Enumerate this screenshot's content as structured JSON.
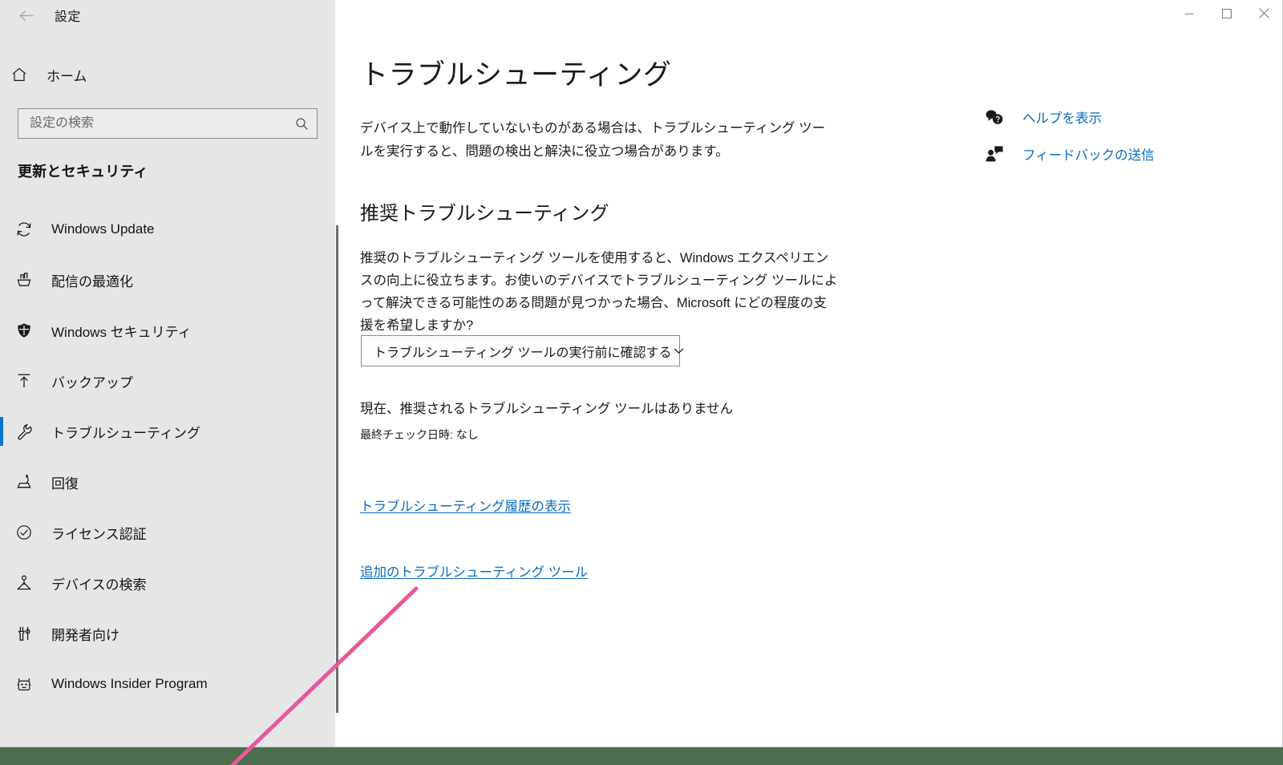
{
  "window": {
    "title": "設定",
    "back_icon": "back-arrow-icon",
    "controls": {
      "minimize": "minimize-icon",
      "maximize": "maximize-icon",
      "close": "close-icon"
    }
  },
  "sidebar": {
    "home": {
      "label": "ホーム",
      "icon": "home-icon"
    },
    "search": {
      "placeholder": "設定の検索",
      "value": "",
      "icon": "search-icon"
    },
    "group_title": "更新とセキュリティ",
    "items": [
      {
        "label": "Windows Update",
        "icon": "sync-refresh-icon",
        "selected": false
      },
      {
        "label": "配信の最適化",
        "icon": "delivery-optimization-icon",
        "selected": false
      },
      {
        "label": "Windows セキュリティ",
        "icon": "shield-icon",
        "selected": false
      },
      {
        "label": "バックアップ",
        "icon": "backup-upload-icon",
        "selected": false
      },
      {
        "label": "トラブルシューティング",
        "icon": "wrench-icon",
        "selected": true
      },
      {
        "label": "回復",
        "icon": "recovery-icon",
        "selected": false
      },
      {
        "label": "ライセンス認証",
        "icon": "check-circle-icon",
        "selected": false
      },
      {
        "label": "デバイスの検索",
        "icon": "find-device-icon",
        "selected": false
      },
      {
        "label": "開発者向け",
        "icon": "developer-tools-icon",
        "selected": false
      },
      {
        "label": "Windows Insider Program",
        "icon": "insider-cat-icon",
        "selected": false
      }
    ],
    "accent_color": "#0078d4"
  },
  "main": {
    "page_title": "トラブルシューティング",
    "intro_text": "デバイス上で動作していないものがある場合は、トラブルシューティング ツールを実行すると、問題の検出と解決に役立つ場合があります。",
    "section_title": "推奨トラブルシューティング",
    "section_text": "推奨のトラブルシューティング ツールを使用すると、Windows エクスペリエンスの向上に役立ちます。お使いのデバイスでトラブルシューティング ツールによって解決できる可能性のある問題が見つかった場合、Microsoft にどの程度の支援を希望しますか?",
    "dropdown": {
      "value": "トラブルシューティング ツールの実行前に確認する",
      "chevron_icon": "chevron-down-icon"
    },
    "status_primary": "現在、推奨されるトラブルシューティング ツールはありません",
    "status_secondary": "最終チェック日時: なし",
    "links": [
      {
        "label": "トラブルシューティング履歴の表示"
      },
      {
        "label": "追加のトラブルシューティング ツール"
      }
    ],
    "link_color": "#0a6cbd"
  },
  "help": {
    "items": [
      {
        "label": "ヘルプを表示",
        "icon": "help-question-bubble-icon"
      },
      {
        "label": "フィードバックの送信",
        "icon": "feedback-person-icon"
      }
    ]
  },
  "annotation": {
    "color": "#e8579c",
    "shape": "pointer-line"
  },
  "desktop": {
    "strip_color": "#4c6e4e"
  }
}
